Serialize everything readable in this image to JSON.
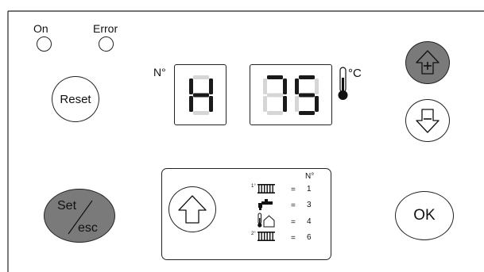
{
  "indicators": {
    "on_label": "On",
    "error_label": "Error"
  },
  "buttons": {
    "reset_label": "Reset",
    "set_label": "Set",
    "esc_label": "esc",
    "ok_label": "OK"
  },
  "display": {
    "number_label": "N°",
    "mode_char": "H",
    "temperature_value": "75",
    "unit": "°C"
  },
  "legend": {
    "header": "N°",
    "rows": [
      {
        "prefix": "1°",
        "icon": "radiator-icon",
        "equals": "=",
        "value": "1"
      },
      {
        "prefix": "",
        "icon": "tap-icon",
        "equals": "=",
        "value": "3"
      },
      {
        "prefix": "",
        "icon": "outdoor-thermometer-house-icon",
        "equals": "=",
        "value": "4"
      },
      {
        "prefix": "2°",
        "icon": "radiator-icon",
        "equals": "=",
        "value": "6"
      }
    ]
  },
  "colors": {
    "active_button_fill": "#7a7a7a",
    "segment_off": "#d6d6d6",
    "segment_on": "#1a1a1a"
  }
}
